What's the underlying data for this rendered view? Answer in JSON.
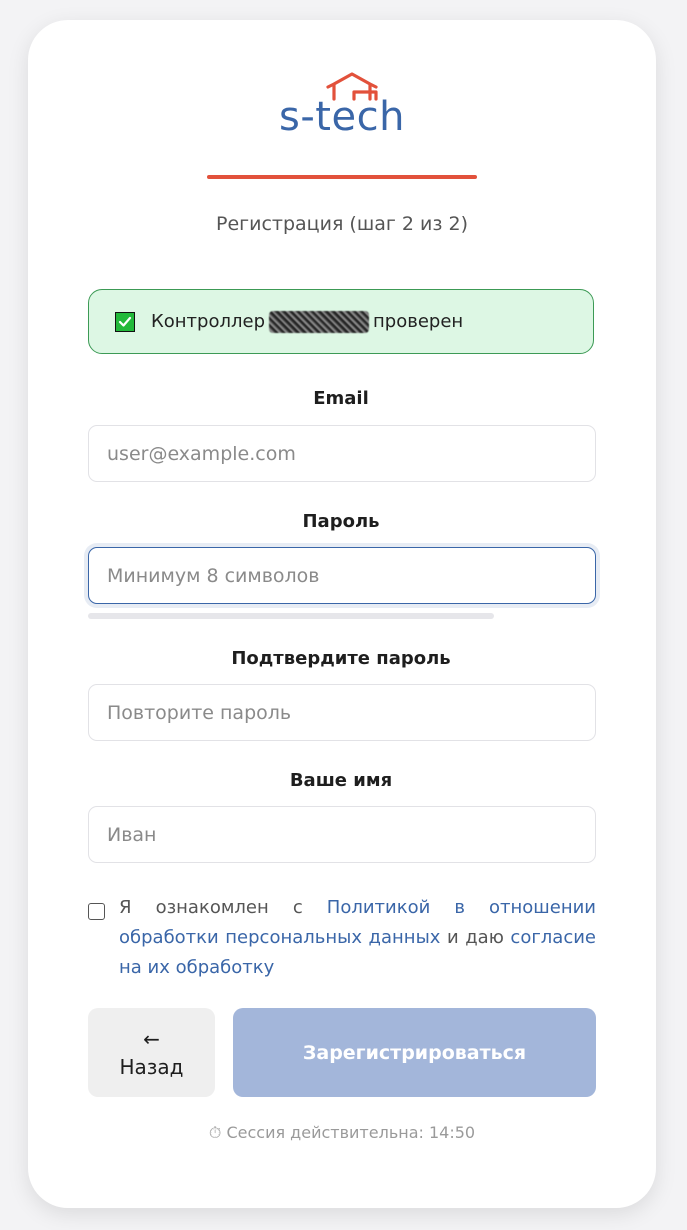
{
  "logo": {
    "text": "s-tech",
    "house_color": "#e2513b",
    "text_color": "#3a66a8"
  },
  "header": {
    "subtitle": "Регистрация (шаг 2 из 2)"
  },
  "alert": {
    "prefix": "Контроллер",
    "suffix": "проверен",
    "redacted_icon": "redacted-scribble",
    "check_icon": "check-icon"
  },
  "form": {
    "email": {
      "label": "Email",
      "value": "",
      "placeholder": "user@example.com"
    },
    "password": {
      "label": "Пароль",
      "value": "",
      "placeholder": "Минимум 8 символов",
      "strength": 0
    },
    "confirm": {
      "label": "Подтвердите пароль",
      "value": "",
      "placeholder": "Повторите пароль"
    },
    "name": {
      "label": "Ваше имя",
      "value": "",
      "placeholder": "Иван"
    }
  },
  "consent": {
    "checked": false,
    "text_before": "Я ознакомлен с ",
    "link": "Политикой в отношении обработки персональных данных",
    "text_middle": " и даю ",
    "link2": "согласие на их обработку"
  },
  "buttons": {
    "back_arrow": "←",
    "back_label": "Назад",
    "submit_label": "Зарегистрироваться"
  },
  "session": {
    "icon": "timer-icon",
    "text": "⏱ Сессия действительна: 14:50"
  },
  "colors": {
    "accent": "#e2513b",
    "brand": "#3a66a8",
    "success_bg": "#ddf7e4",
    "success_border": "#3c9a55",
    "submit_disabled": "#a3b6da"
  }
}
